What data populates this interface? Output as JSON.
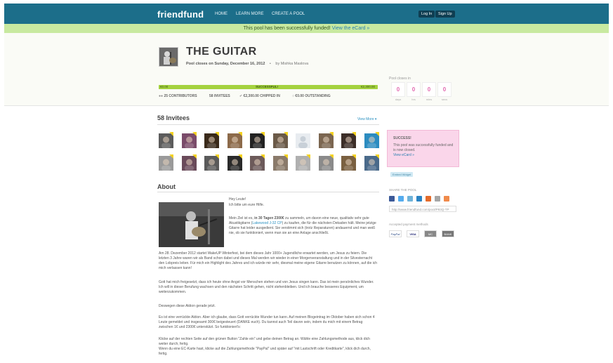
{
  "nav": {
    "logo": "friendfund",
    "items": [
      "HOME",
      "LEARN MORE",
      "CREATE A POOL"
    ],
    "login": "Log In",
    "signup": "Sign Up"
  },
  "banner": {
    "text": "This pool has been successfully funded!",
    "link": "View the eCard »"
  },
  "pool": {
    "title": "THE GUITAR",
    "closes": "Pool closes on Sunday, December 16, 2012",
    "separator": "•",
    "by": "by Mishka Maslova",
    "progress_left": "€0.00",
    "progress_mid": "SUCCESSFUL!",
    "progress_right": "€2,300.00",
    "progress_fraction": 1.0,
    "stats": {
      "contributors": "25 CONTRIBUTORS",
      "invitees": "58 INVITEES",
      "chipped": "€2,300.00 CHIPPED IN",
      "outstanding": "€0.00 OUTSTANDING"
    }
  },
  "countdown": {
    "label": "Pool closes in",
    "days": "0",
    "hrs": "0",
    "mins": "0",
    "secs": "0",
    "units": [
      "days",
      "hrs",
      "mins",
      "secs"
    ]
  },
  "invitees": {
    "heading": "58 Invitees",
    "view_more": "View More ▾"
  },
  "about": {
    "heading": "About",
    "greeting": "Hey Leute!",
    "greeting2": "Ich bitte um eure Hilfe.",
    "p1_pre": "Mein Ziel ist es, ",
    "p1_bold": "in 30 Tagen 2300€",
    "p1_mid": " zu sammeln, um davon eine neue, qualitativ sehr gute Akustikgitarre (",
    "p1_link": "Lakewood J-32 CP",
    "p1_post": ") zu kaufen, die für die nächsten Dekaden hält. Meine jetzige Gitarre hat leider ausgedient. Sie verstimmt sich (trotz Reparaturen) andauernd und man weiß nie, ob sie funktioniert, wenn man sie an eine Anlage anschließt.",
    "p2": "Am 28. Dezember 2012 startet WakeUP Winterfest, bei dem dieses Jahr 1000+ Jugendliche erwartet werden, um Jesus zu feiern. Die letzten 3 Jahre waren wir als Band schon dabei und dieses Mal werden wir wieder in einer Morgenveranstaltung und in der Silvesternacht den Lobpreis leiten. Für mich ein Highlight des Jahres und ich würde mir sehr, diesmal meine eigene Gitarre benutzen zu können, auf die ich mich verlassen kann!",
    "p3": "Gott hat mich freigesetzt, dass ich heute ohne Angst vor Menschen stehen und von Jesus singen kann. Das ist mein persönliches Wunder. Ich will in dieser Berufung wachsen und den nächsten Schritt gehen, nicht stehenbleiben. Und ich brauche besseres Equipment, um weiterzukommen.",
    "p4": "Deswegen diese Aktion gerade jetzt.",
    "p5": "Es ist eine verrückte Aktion. Aber ich glaube, dass Gott verrückte Wunder tun kann. Auf meinen Blogeintrag im Oktober haben sich schon 4 Leute gemeldet und insgesamt 300€ beigesteuert (DANKE euch). Du kannst auch Teil davon sein, indem du mich mit einem Betrag zwischen 1€ und 2300€ unterstützt. So funktioniert's:",
    "p6a": "Klicke auf der rechten Seite auf den grünen Button \"Zahle ein\" und gebe deinen Betrag an. Wähle eine Zahlungsmethode aus, klick dich weiter durch, fertig.",
    "p6b": "Wenn du eine EC-Karte hast, klicke auf die Zahlungsmethode \"PayPal\" und später auf \"mit Lastschrift oder Kreditkarte\", klick dich durch, fertig."
  },
  "sidebar": {
    "success_title": "SUCCESS!",
    "success_text": "This pool was successfully funded and is now closed.",
    "success_link": "View eCard »",
    "embed": "Embed Widget",
    "share_label": "SHARE THE POOL",
    "share_url": "http://www.friendfund.com/pool/P93Q-TP",
    "payment_label": "Accepted payment methods",
    "payments": [
      "PayPal",
      "VISA",
      "MC",
      "BANK"
    ]
  },
  "colors": {
    "topbar": "#1c6e8a",
    "banner": "#c8e9a0",
    "progress": "#b8e25a",
    "accent_link": "#2a90c0",
    "countdown": "#e26ab0",
    "success_box": "#fad6ea",
    "checkmark": "#f4d21f"
  },
  "icons": [
    "check-icon",
    "contributors-icon",
    "chip-icon",
    "facebook-icon",
    "twitter-icon",
    "email-icon",
    "share-icon"
  ]
}
